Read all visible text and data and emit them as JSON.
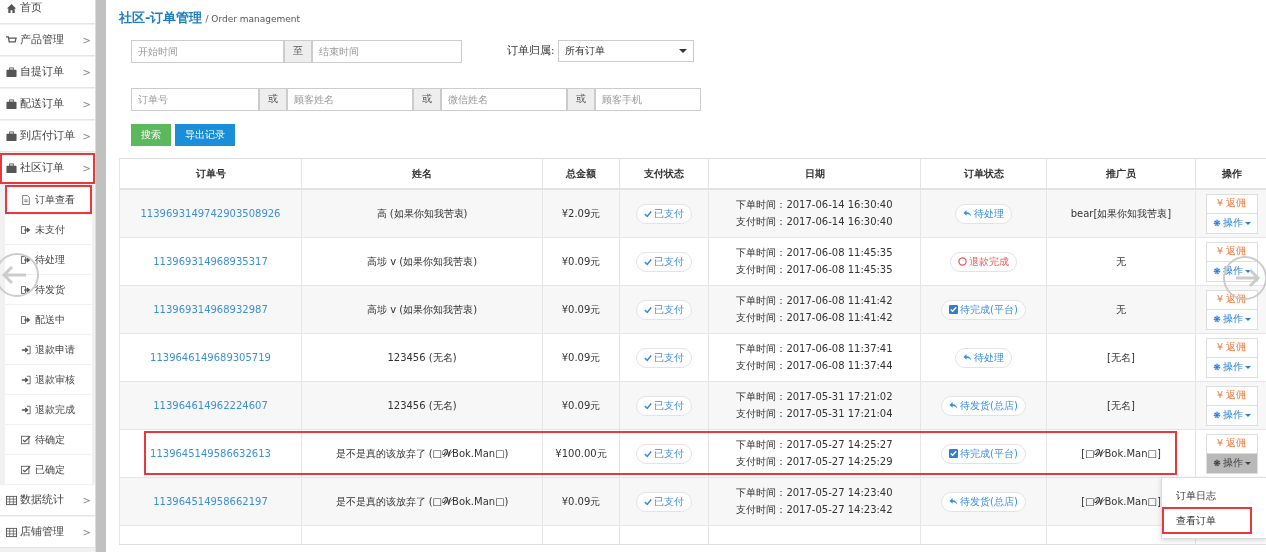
{
  "sidebar": {
    "items": [
      {
        "kind": "home",
        "label": "首页",
        "highlighted": false
      },
      {
        "kind": "cart",
        "label": "产品管理",
        "arrow": ">",
        "highlighted": false
      },
      {
        "kind": "briefcase",
        "label": "自提订单",
        "arrow": ">",
        "highlighted": false
      },
      {
        "kind": "briefcase",
        "label": "配送订单",
        "arrow": ">",
        "highlighted": false
      },
      {
        "kind": "briefcase",
        "label": "到店付订单",
        "arrow": ">",
        "highlighted": false
      },
      {
        "kind": "briefcase",
        "label": "社区订单",
        "arrow": ">",
        "highlighted": true,
        "children": [
          {
            "kind": "file",
            "label": "订单查看",
            "highlighted": true
          },
          {
            "kind": "exit",
            "label": "未支付",
            "highlighted": false
          },
          {
            "kind": "exit",
            "label": "待处理",
            "highlighted": false
          },
          {
            "kind": "exit",
            "label": "待发货",
            "highlighted": false
          },
          {
            "kind": "exit",
            "label": "配送中",
            "highlighted": false
          },
          {
            "kind": "enter",
            "label": "退款申请",
            "highlighted": false
          },
          {
            "kind": "enter",
            "label": "退款审核",
            "highlighted": false
          },
          {
            "kind": "enter",
            "label": "退款完成",
            "highlighted": false
          },
          {
            "kind": "check",
            "label": "待确定",
            "highlighted": false
          },
          {
            "kind": "check",
            "label": "已确定",
            "highlighted": false
          }
        ]
      },
      {
        "kind": "table",
        "label": "数据统计",
        "arrow": ">",
        "highlighted": false
      },
      {
        "kind": "table",
        "label": "店铺管理",
        "arrow": ">",
        "highlighted": false
      }
    ]
  },
  "page": {
    "title": "社区-订单管理",
    "subtitle": "/ Order management"
  },
  "filters": {
    "start": {
      "placeholder": "开始时间"
    },
    "to": "至",
    "end": {
      "placeholder": "结束时间"
    },
    "owner_label": "订单归属:",
    "owner_value": "所有订单",
    "order_no": {
      "placeholder": "订单号"
    },
    "or_1": "或",
    "customer_name": {
      "placeholder": "顾客姓名"
    },
    "or_2": "或",
    "wechat_name": {
      "placeholder": "微信姓名"
    },
    "or_3": "或",
    "customer_phone": {
      "placeholder": "顾客手机"
    }
  },
  "buttons": {
    "search": "搜索",
    "export": "导出记录"
  },
  "table": {
    "columns": [
      "订单号",
      "姓名",
      "总金额",
      "支付状态",
      "日期",
      "订单状态",
      "推广员",
      "操作"
    ],
    "rows": [
      {
        "id": "1139693149742903508926",
        "name": "高 (如果你知我苦衷)",
        "amount": "¥2.09元",
        "pay_status": "已支付",
        "order_time": "下单时间：2017-06-14 16:30:40",
        "pay_time": "支付时间：2017-06-14 16:30:40",
        "status": {
          "kind": "reply",
          "label": "待处理"
        },
        "promoter": "bear[如果你知我苦衷]",
        "refund": "¥ 返佣",
        "ops": "操作",
        "highlighted": false,
        "menu_open": false
      },
      {
        "id": "113969314968935317",
        "name": "高埗 v (如果你知我苦衷)",
        "amount": "¥0.09元",
        "pay_status": "已支付",
        "order_time": "下单时间：2017-06-08 11:45:35",
        "pay_time": "支付时间：2017-06-08 11:45:35",
        "status": {
          "kind": "refund",
          "label": "退款完成"
        },
        "promoter": "无",
        "refund": "¥ 返佣",
        "ops": "操作",
        "highlighted": false,
        "menu_open": false
      },
      {
        "id": "113969314968932987",
        "name": "高埗 v (如果你知我苦衷)",
        "amount": "¥0.09元",
        "pay_status": "已支付",
        "order_time": "下单时间：2017-06-08 11:41:42",
        "pay_time": "支付时间：2017-06-08 11:41:42",
        "status": {
          "kind": "check",
          "label": "待完成(平台)"
        },
        "promoter": "无",
        "refund": "¥ 返佣",
        "ops": "操作",
        "highlighted": false,
        "menu_open": false
      },
      {
        "id": "1139646149689305719",
        "name": "123456 (无名)",
        "amount": "¥0.09元",
        "pay_status": "已支付",
        "order_time": "下单时间：2017-06-08 11:37:41",
        "pay_time": "支付时间：2017-06-08 11:37:44",
        "status": {
          "kind": "reply",
          "label": "待处理"
        },
        "promoter": "[无名]",
        "refund": "¥ 返佣",
        "ops": "操作",
        "highlighted": false,
        "menu_open": false
      },
      {
        "id": "113964614962224607",
        "name": "123456 (无名)",
        "amount": "¥0.09元",
        "pay_status": "已支付",
        "order_time": "下单时间：2017-05-31 17:21:02",
        "pay_time": "支付时间：2017-05-31 17:21:04",
        "status": {
          "kind": "reply",
          "label": "待发货(总店)"
        },
        "promoter": "[无名]",
        "refund": "¥ 返佣",
        "ops": "操作",
        "highlighted": false,
        "menu_open": false
      },
      {
        "id": "1139645149586632613",
        "name": "是不是真的该放弃了 (□𝓦Bok.Man□)",
        "amount": "¥100.00元",
        "pay_status": "已支付",
        "order_time": "下单时间：2017-05-27 14:25:27",
        "pay_time": "支付时间：2017-05-27 14:25:29",
        "status": {
          "kind": "check",
          "label": "待完成(平台)"
        },
        "promoter": "[□𝓦Bok.Man□]",
        "refund": "¥ 返佣",
        "ops": "操作",
        "highlighted": true,
        "menu_open": true,
        "menu": [
          {
            "label": "订单日志",
            "highlighted": false
          },
          {
            "label": "查看订单",
            "highlighted": true
          }
        ]
      },
      {
        "id": "113964514958662197",
        "name": "是不是真的该放弃了 (□𝓦Bok.Man□)",
        "amount": "¥0.09元",
        "pay_status": "已支付",
        "order_time": "下单时间：2017-05-27 14:23:40",
        "pay_time": "支付时间：2017-05-27 14:23:42",
        "status": {
          "kind": "reply",
          "label": "待发货(总店)"
        },
        "promoter": "[□𝓦Bok.Man□]",
        "highlighted": false
      },
      {
        "highlighted": false
      }
    ]
  }
}
